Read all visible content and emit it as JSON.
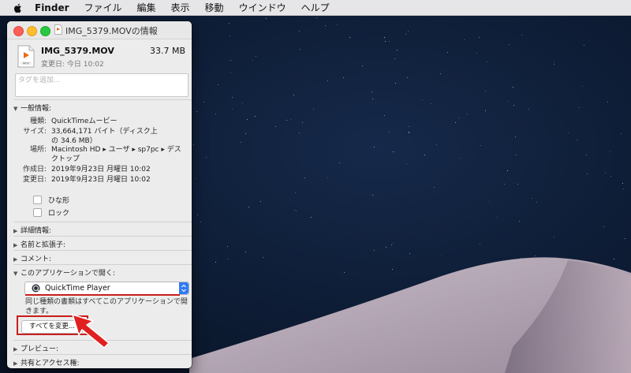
{
  "menubar": {
    "items": [
      "Finder",
      "ファイル",
      "編集",
      "表示",
      "移動",
      "ウインドウ",
      "ヘルプ"
    ]
  },
  "window": {
    "title": "IMG_5379.MOVの情報",
    "file_name": "IMG_5379.MOV",
    "file_size": "33.7 MB",
    "modified_short": "変更日: 今日 10:02",
    "tags_placeholder": "タグを追加...",
    "general": {
      "header": "一般情報:",
      "rows": [
        {
          "key": "種類:",
          "value": "QuickTimeムービー"
        },
        {
          "key": "サイズ:",
          "value": "33,664,171 バイト（ディスク上の 34.6 MB）"
        },
        {
          "key": "場所:",
          "value": "Macintosh HD ▸ ユーザ ▸ sp7pc ▸ デスクトップ"
        },
        {
          "key": "作成日:",
          "value": "2019年9月23日 月曜日 10:02"
        },
        {
          "key": "変更日:",
          "value": "2019年9月23日 月曜日 10:02"
        }
      ],
      "stationery_label": "ひな形",
      "locked_label": "ロック"
    },
    "more_info": "詳細情報:",
    "name_ext": "名前と拡張子:",
    "comments": "コメント:",
    "open_with": {
      "header": "このアプリケーションで開く:",
      "app": "QuickTime Player",
      "description": "同じ種類の書類はすべてこのアプリケーションで開きます。",
      "change_all": "すべてを変更..."
    },
    "preview": "プレビュー:",
    "sharing": "共有とアクセス権:"
  },
  "colors": {
    "highlight": "#c81e1e",
    "accent": "#2f7bf5"
  }
}
